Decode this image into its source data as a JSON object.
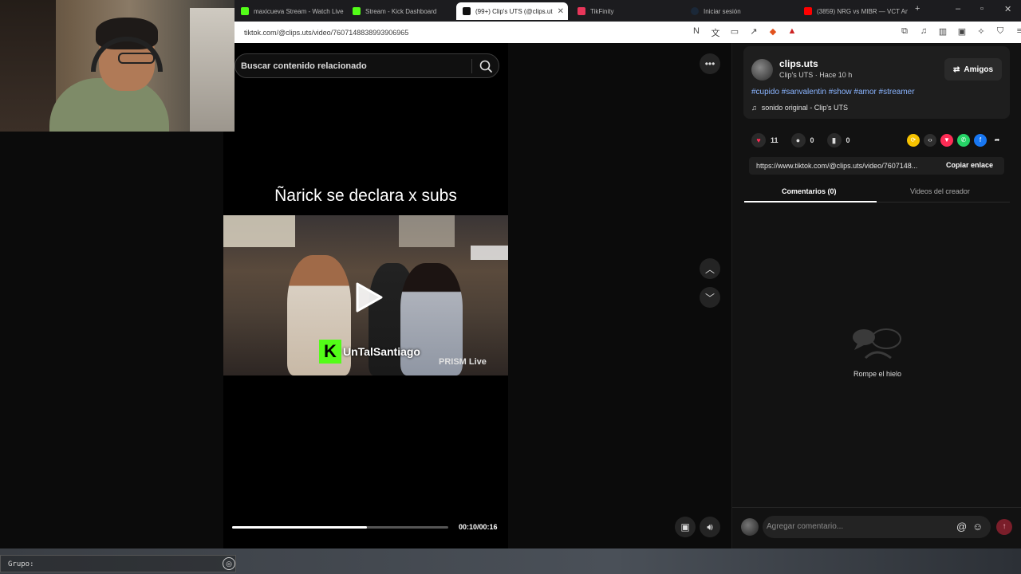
{
  "browser": {
    "tabs": [
      {
        "title": "maxicueva Stream - Watch Live",
        "favicon": "kick-icon",
        "color": "#53fc18"
      },
      {
        "title": "Stream - Kick Dashboard",
        "favicon": "kick-icon",
        "color": "#53fc18"
      },
      {
        "title": "(99+) Clip's UTS (@clips.ut",
        "favicon": "tiktok-icon",
        "color": "#111111",
        "active": true
      },
      {
        "title": "TikFinity",
        "favicon": "tikfinity-icon",
        "color": "#e8365a"
      },
      {
        "title": "Iniciar sesión",
        "favicon": "steam-icon",
        "color": "#1b2838"
      },
      {
        "title": "(3859) NRG vs MIBR — VCT Am",
        "favicon": "youtube-icon",
        "color": "#ff0000"
      }
    ],
    "url": "tiktok.com/@clips.uts/video/7607148838993906965"
  },
  "search": {
    "placeholder": "Buscar contenido relacionado"
  },
  "video": {
    "title": "Ñarick se declara x subs",
    "streamer_name": "UnTalSantiago",
    "watermark": "PRISM Live",
    "time": "00:10/00:16",
    "progress_fraction": 0.625
  },
  "author": {
    "handle": "clips.uts",
    "subtitle": "Clip's UTS · Hace 10 h",
    "friends_button": "Amigos"
  },
  "post": {
    "hashtags": "#cupido #sanvalentin #show #amor #streamer",
    "sound": "sonido original - Clip's UTS"
  },
  "stats": {
    "likes": "11",
    "comments": "0",
    "saves": "0"
  },
  "share": {
    "link": "https://www.tiktok.com/@clips.uts/video/7607148...",
    "copy_label": "Copiar enlace"
  },
  "panel_tabs": {
    "comments": "Comentarios (0)",
    "creator_videos": "Videos del creador"
  },
  "empty_state": {
    "text": "Rompe el hielo"
  },
  "composer": {
    "placeholder": "Agregar comentario..."
  },
  "taskbar": {
    "group_label": "Grupo:"
  },
  "colors": {
    "like": "#fe2c55",
    "hashtag": "#8ab4ff",
    "kick": "#53fc18"
  }
}
